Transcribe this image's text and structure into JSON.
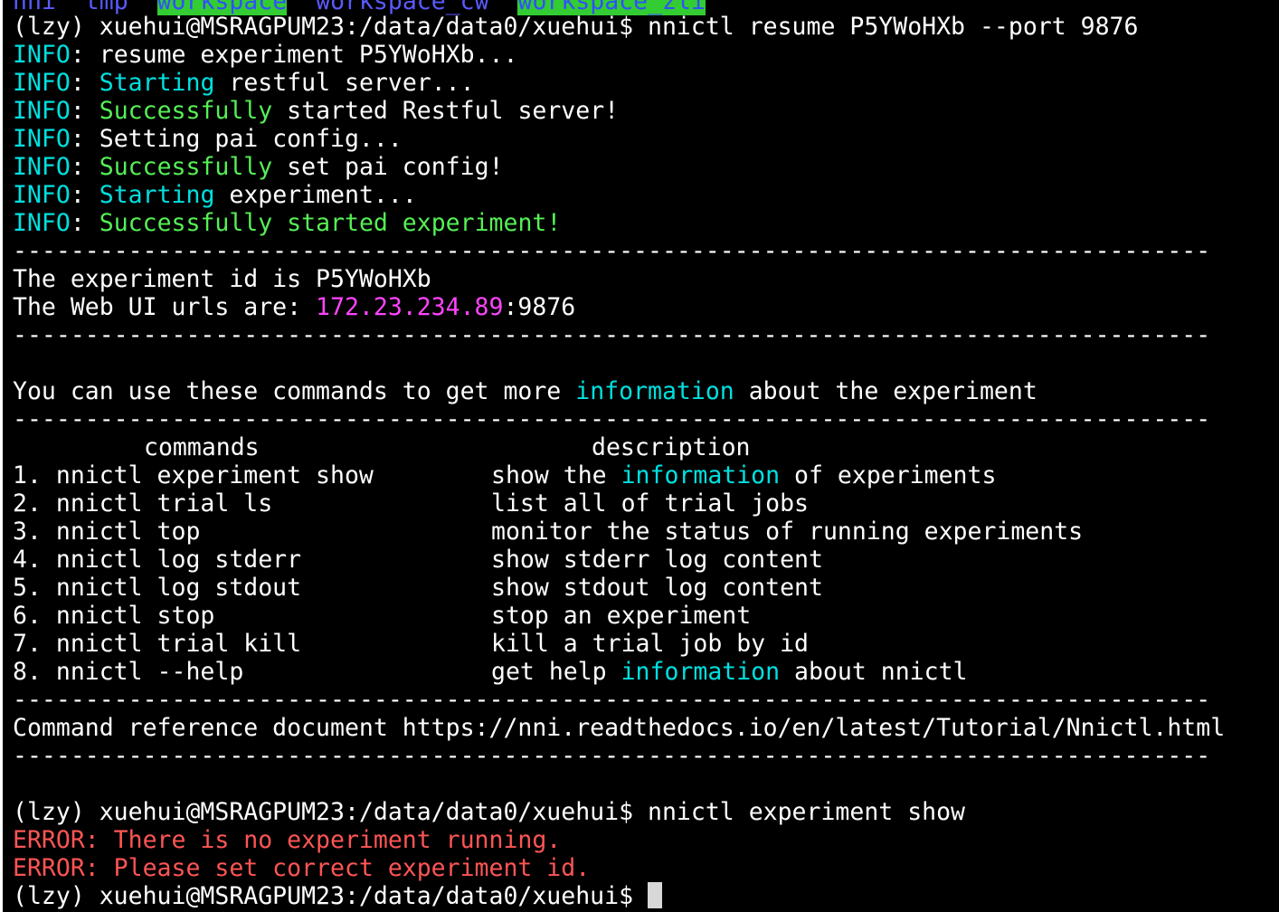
{
  "terminal": {
    "colors": {
      "background": "#000000",
      "text": "#ffffff",
      "info": "#00e0e0",
      "success": "#55f055",
      "ip": "#ff44ff",
      "error": "#ff5555",
      "dir_highlight_bg": "#33cc33"
    },
    "top_listing": [
      "nni",
      "tmp",
      "workspace",
      "workspace_cw",
      "workspace_zli"
    ],
    "prompt": "(lzy) xuehui@MSRAGPUM23:/data/data0/xuehui$",
    "cmd1": "nnictl resume P5YWoHXb --port 9876",
    "info_prefix": "INFO",
    "colon": ":",
    "log": {
      "l1_text": " resume experiment P5YWoHXb...",
      "starting": "Starting",
      "l2_rest": " restful server...",
      "successfully": "Successfully",
      "l3_rest": " started Restful server!",
      "l4_text": " Setting pai config...",
      "l5_rest": " set pai config!",
      "l6_rest": " experiment...",
      "l7_rest": " started experiment!"
    },
    "divider": "-----------------------------------------------------------------------------------",
    "exp_id_line": "The experiment id is P5YWoHXb",
    "webui_label": "The Web UI urls are: ",
    "webui_ip": "172.23.234.89",
    "webui_port": ":9876",
    "use_prefix": "You can use these commands to get more ",
    "information": "information",
    "use_suffix": " about the experiment",
    "header_commands": "commands",
    "header_description": "description",
    "commands": [
      {
        "cmd": "1. nnictl experiment show",
        "desc_pre": "show the ",
        "desc_hl": "information",
        "desc_post": " of experiments"
      },
      {
        "cmd": "2. nnictl trial ls",
        "desc_pre": "list all of trial jobs",
        "desc_hl": "",
        "desc_post": ""
      },
      {
        "cmd": "3. nnictl top",
        "desc_pre": "monitor the status of running experiments",
        "desc_hl": "",
        "desc_post": ""
      },
      {
        "cmd": "4. nnictl log stderr",
        "desc_pre": "show stderr log content",
        "desc_hl": "",
        "desc_post": ""
      },
      {
        "cmd": "5. nnictl log stdout",
        "desc_pre": "show stdout log content",
        "desc_hl": "",
        "desc_post": ""
      },
      {
        "cmd": "6. nnictl stop",
        "desc_pre": "stop an experiment",
        "desc_hl": "",
        "desc_post": ""
      },
      {
        "cmd": "7. nnictl trial kill",
        "desc_pre": "kill a trial job by id",
        "desc_hl": "",
        "desc_post": ""
      },
      {
        "cmd": "8. nnictl --help",
        "desc_pre": "get help ",
        "desc_hl": "information",
        "desc_post": " about nnictl"
      }
    ],
    "ref_doc": "Command reference document https://nni.readthedocs.io/en/latest/Tutorial/Nnictl.html",
    "cmd2": "nnictl experiment show",
    "errors": [
      "ERROR: There is no experiment running.",
      "ERROR: Please set correct experiment id."
    ]
  }
}
